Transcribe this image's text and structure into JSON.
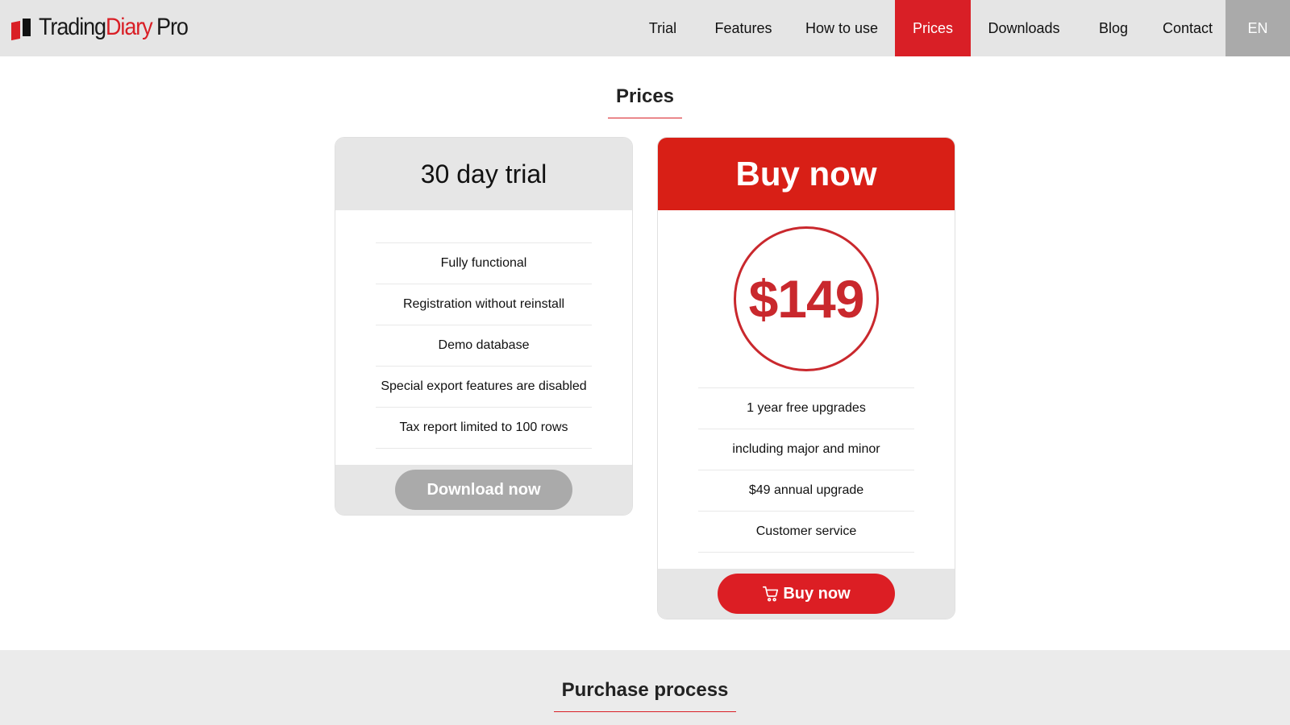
{
  "brand": {
    "name_part1": "Trading",
    "name_part2": "Diary",
    "name_part3": "Pro",
    "accent_color": "#d91f26"
  },
  "nav": {
    "items": [
      {
        "label": "Trial"
      },
      {
        "label": "Features"
      },
      {
        "label": "How to use"
      },
      {
        "label": "Prices",
        "active": true
      },
      {
        "label": "Downloads"
      },
      {
        "label": "Blog"
      },
      {
        "label": "Contact"
      }
    ],
    "language": "EN"
  },
  "prices_section": {
    "title": "Prices",
    "trial_card": {
      "title": "30 day trial",
      "features": [
        "Fully functional",
        "Registration without reinstall",
        "Demo database",
        "Special export features are disabled",
        "Tax report limited to 100 rows"
      ],
      "button_label": "Download now"
    },
    "buy_card": {
      "title": "Buy now",
      "price": "$149",
      "features": [
        "1 year free upgrades",
        "including major and minor",
        "$49 annual upgrade",
        "Customer service"
      ],
      "button_icon": "cart-icon",
      "button_label": "Buy now"
    }
  },
  "purchase_section": {
    "title": "Purchase process"
  }
}
